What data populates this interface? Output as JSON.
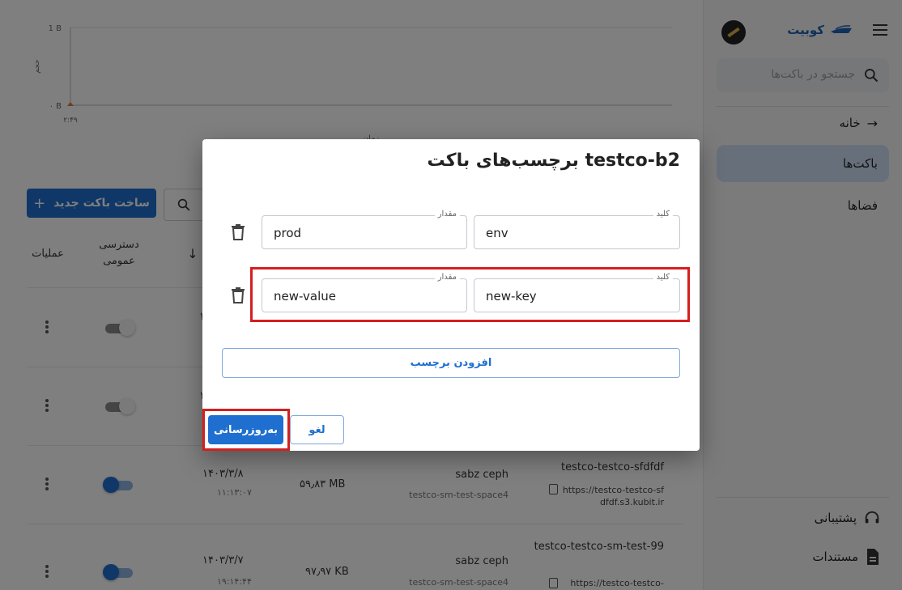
{
  "sidebar": {
    "brand": "کوبیت",
    "search_placeholder": "جستجو در باکت‌ها",
    "items": [
      {
        "label": "خانه"
      },
      {
        "label": "باکت‌ها"
      },
      {
        "label": "فضاها"
      }
    ],
    "footer": [
      {
        "label": "پشتیبانی"
      },
      {
        "label": "مستندات"
      }
    ]
  },
  "chart": {
    "y_top": "1 B",
    "y_bottom": "۰ B",
    "x_tick": "۲:۴۹",
    "ylabel": "حجم",
    "xlabel": "زمان"
  },
  "toolbar": {
    "new_bucket": "ساخت باکت جدید"
  },
  "table": {
    "headers": {
      "operations": "عملیات",
      "public_access": "دسترسی عمومی"
    },
    "rows": [
      {
        "date": "۱",
        "time": "",
        "size": "",
        "space_name": "",
        "space_id": "",
        "bucket": "",
        "url": "",
        "public": false
      },
      {
        "date": "۱",
        "time": "",
        "size": "",
        "space_name": "",
        "space_id": "",
        "bucket": "",
        "url": "",
        "public": false
      },
      {
        "date": "۱۴۰۳/۳/۸",
        "time": "۱۱:۱۳:۰۷",
        "size": "۵۹٫۸۳ MB",
        "space_name": "sabz ceph",
        "space_id": "testco-sm-test-space4",
        "bucket": "testco-testco-sfdfdf",
        "url": "https://testco-testco-sfdfdf.s3.kubit.ir",
        "public": true
      },
      {
        "date": "۱۴۰۳/۳/۷",
        "time": "۱۹:۱۴:۴۴",
        "size": "۹۷٫۹۷ KB",
        "space_name": "sabz ceph",
        "space_id": "testco-sm-test-space4",
        "bucket": "testco-testco-sm-test-99",
        "url": "https://testco-testco-",
        "public": true
      }
    ]
  },
  "dialog": {
    "title": "برچسب‌های باکت testco-b2",
    "key_label": "کلید",
    "value_label": "مقدار",
    "tags": [
      {
        "key": "env",
        "value": "prod"
      },
      {
        "key": "new-key",
        "value": "new-value"
      }
    ],
    "add_tag": "افزودن برچسب",
    "update": "به‌روزرسانی",
    "cancel": "لغو"
  },
  "colors": {
    "primary": "#1e6fd0",
    "highlight": "#d41f1f",
    "active_nav": "#cfe0f5"
  }
}
